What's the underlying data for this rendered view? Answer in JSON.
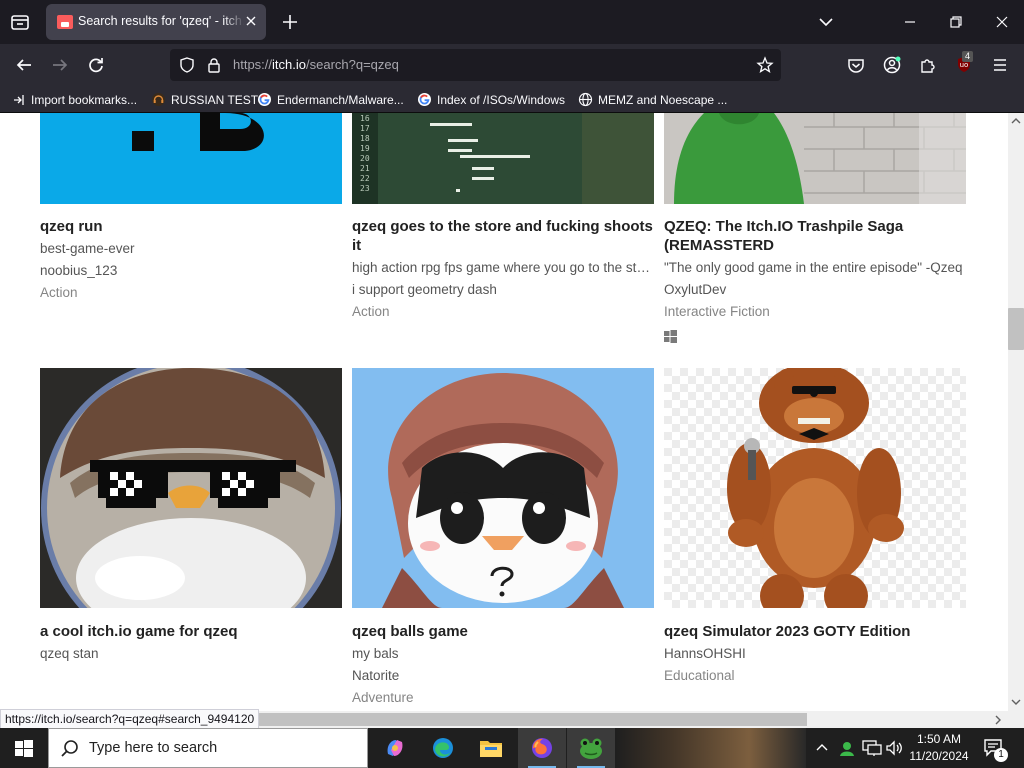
{
  "browser": {
    "tab_title": "Search results for 'qzeq' - itch.io",
    "url_prefix": "https://",
    "url_host": "itch.io",
    "url_path": "/search?q=qzeq",
    "extension_badge": "4",
    "status_url": "https://itch.io/search?q=qzeq#search_9494120"
  },
  "bookmarks": [
    {
      "label": "Import bookmarks...",
      "icon": "import-icon"
    },
    {
      "label": "RUSSIAN TEST",
      "icon": "headset-icon"
    },
    {
      "label": "Endermanch/Malware...",
      "icon": "google-icon"
    },
    {
      "label": "Index of /ISOs/Windows",
      "icon": "google-icon"
    },
    {
      "label": "MEMZ and Noescape ...",
      "icon": "globe-icon"
    }
  ],
  "games_row1": [
    {
      "title": "qzeq run",
      "desc": "best-game-ever",
      "author": "noobius_123",
      "genre": "Action"
    },
    {
      "title": "qzeq goes to the store and fucking shoots it",
      "desc": "high action rpg fps game where you go to the store and shoot it",
      "author": "i support geometry dash",
      "genre": "Action"
    },
    {
      "title": "QZEQ: The Itch.IO Trashpile Saga (REMASSTERD",
      "desc": "\"The only good game in the entire episode\" -Qzeq",
      "author": "OxylutDev",
      "genre": "Interactive Fiction",
      "platform": "windows-icon"
    }
  ],
  "games_row2": [
    {
      "title": "a cool itch.io game for qzeq",
      "author": "qzeq stan"
    },
    {
      "title": "qzeq balls game",
      "desc": "my bals",
      "author": "Natorite",
      "genre": "Adventure"
    },
    {
      "title": "qzeq Simulator 2023 GOTY Edition",
      "author": "HannsOHSHI",
      "genre": "Educational"
    }
  ],
  "code_lines": [
    "16",
    "17",
    "18",
    "19",
    "20",
    "21",
    "22",
    "23"
  ],
  "taskbar": {
    "search_placeholder": "Type here to search",
    "time": "1:50 AM",
    "date": "11/20/2024",
    "notification_count": "1"
  },
  "colors": {
    "tab_bar": "#1c1b22",
    "toolbar": "#2b2a33",
    "itch_accent": "#fa5c5c",
    "thumb_blue": "#0aa9e8",
    "thumb_green": "#3a9a3c"
  }
}
